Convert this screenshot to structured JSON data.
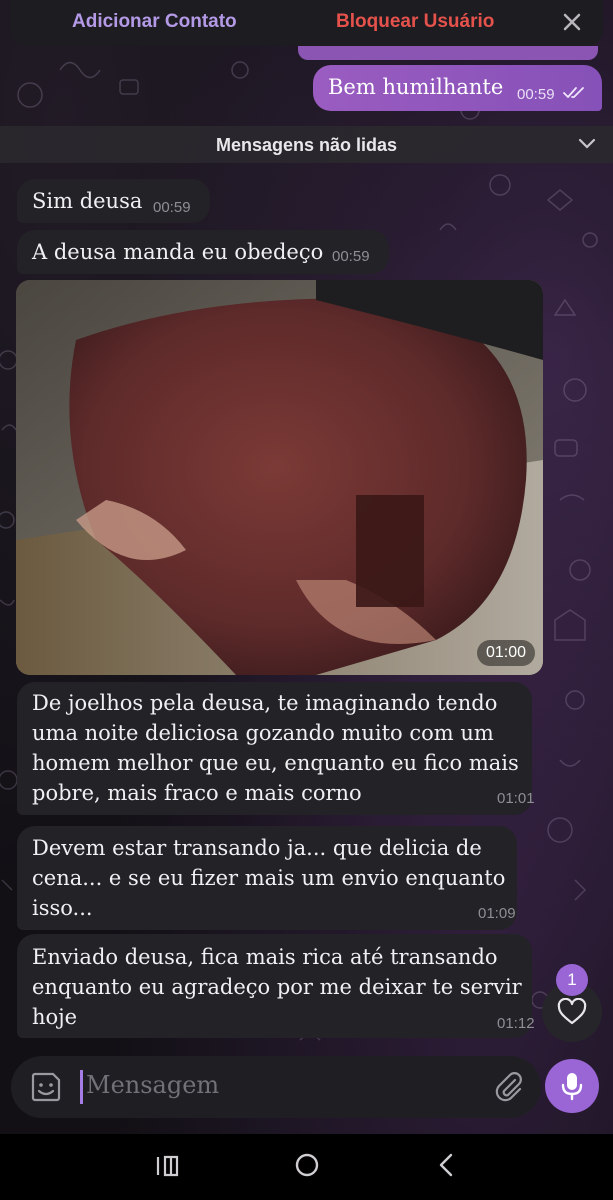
{
  "action_bar": {
    "add_contact": "Adicionar Contato",
    "block_user": "Bloquear Usuário",
    "close_icon": "close-icon"
  },
  "messages": {
    "outgoing": {
      "text": "Bem humilhante",
      "time": "00:59",
      "status_icon": "double-check-icon"
    },
    "unread_divider": "Mensagens não lidas",
    "m1": {
      "text": "Sim deusa",
      "time": "00:59"
    },
    "m2": {
      "text": "A deusa manda eu obedeço",
      "time": "00:59"
    },
    "photo": {
      "time": "01:00"
    },
    "m3": {
      "text": "De joelhos pela deusa, te imaginando tendo uma noite deliciosa gozando muito com um homem melhor que eu, enquanto eu fico mais pobre, mais fraco e mais corno",
      "time": "01:01"
    },
    "m4": {
      "text": "Devem estar transando ja... que delicia de cena... e se eu fizer mais um envio enquanto isso...",
      "time": "01:09"
    },
    "m5": {
      "text": "Enviado deusa, fica mais rica até transando enquanto eu agradeço por me deixar te servir hoje",
      "time": "01:12"
    }
  },
  "reaction": {
    "count": "1",
    "icon": "heart-icon"
  },
  "composer": {
    "placeholder": "Mensagem",
    "left_icon": "sticker-icon",
    "attach_icon": "paperclip-icon",
    "send_icon": "microphone-icon"
  },
  "colors": {
    "accent": "#9a66d6",
    "outgoing_bubble": "#8f56ba",
    "incoming_bubble": "#232227",
    "danger": "#e5524c"
  },
  "navbar": {
    "icons": [
      "recent-apps-icon",
      "home-icon",
      "back-icon"
    ]
  }
}
